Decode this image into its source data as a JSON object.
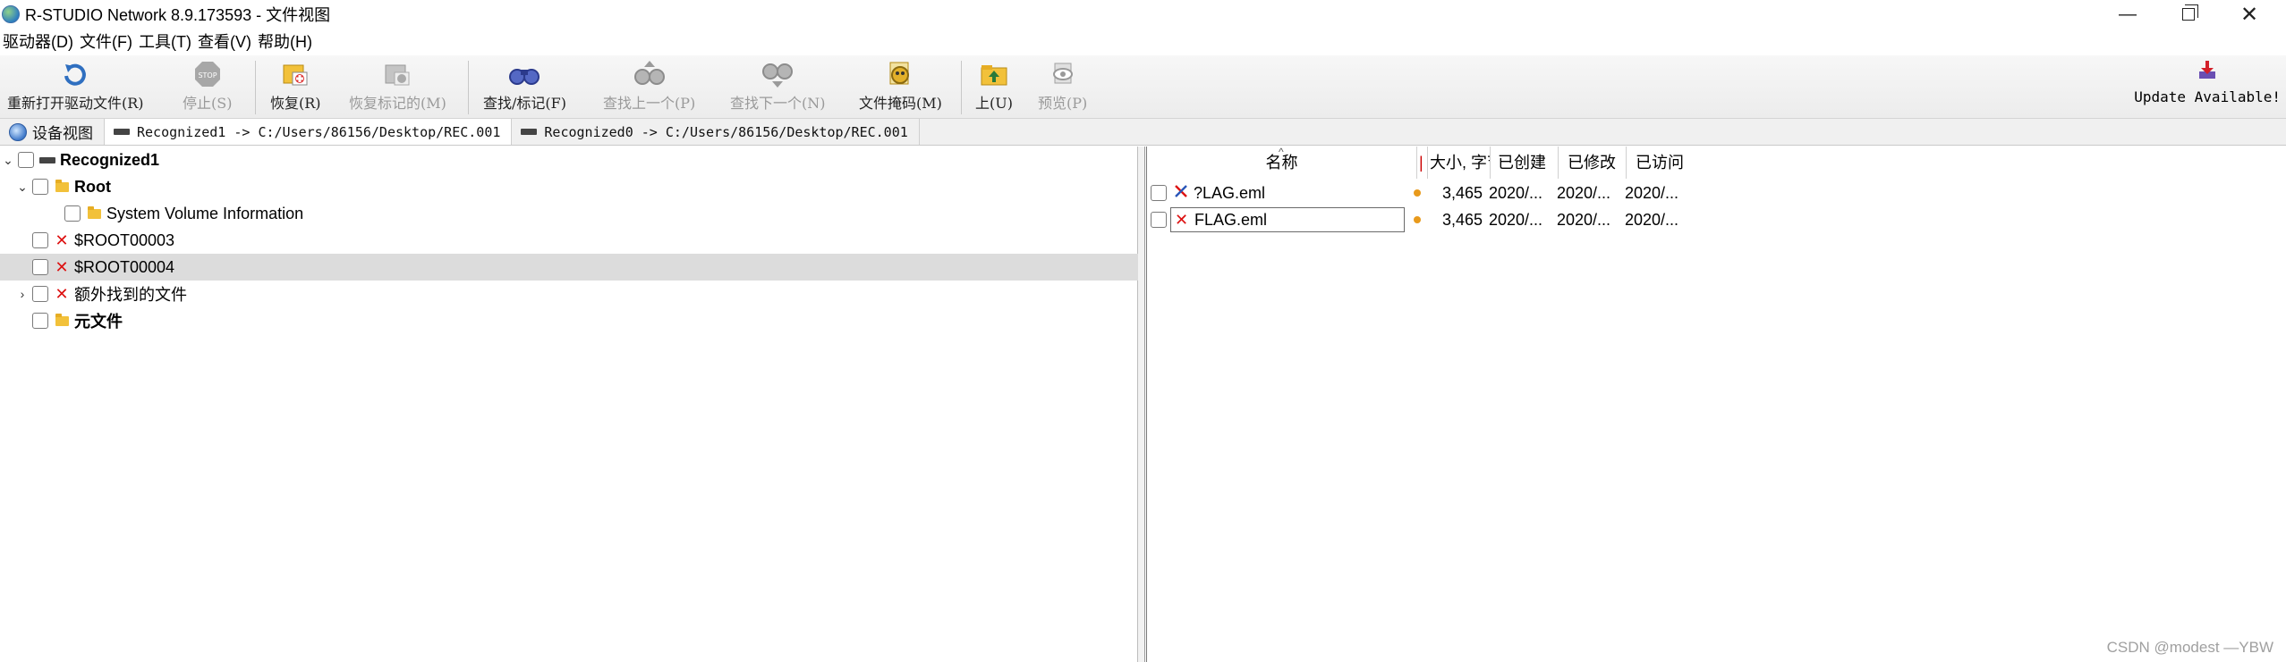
{
  "window": {
    "title": "R-STUDIO Network 8.9.173593 - 文件视图",
    "minimize_glyph": "—",
    "close_glyph": "✕"
  },
  "menu": [
    "驱动器(D)",
    "文件(F)",
    "工具(T)",
    "查看(V)",
    "帮助(H)"
  ],
  "toolbar": {
    "reopen": "重新打开驱动文件(R)",
    "stop": "停止(S)",
    "recover": "恢复(R)",
    "recover_marked": "恢复标记的(M)",
    "find_mark": "查找/标记(F)",
    "find_prev": "查找上一个(P)",
    "find_next": "查找下一个(N)",
    "file_mask": "文件掩码(M)",
    "up": "上(U)",
    "preview": "预览(P)",
    "update": "Update Available!"
  },
  "tabs": [
    {
      "label": "设备视图"
    },
    {
      "label": "Recognized1 -> C:/Users/86156/Desktop/REC.001"
    },
    {
      "label": "Recognized0 -> C:/Users/86156/Desktop/REC.001"
    }
  ],
  "tree": [
    {
      "label": "Recognized1",
      "icon": "drive-icon",
      "bold": true,
      "expanded": true
    },
    {
      "label": "Root",
      "icon": "folder-icon",
      "bold": true,
      "expanded": true
    },
    {
      "label": "System Volume Information",
      "icon": "folder-icon",
      "bold": false
    },
    {
      "label": "$ROOT00003",
      "icon": "deleted-icon",
      "bold": false
    },
    {
      "label": "$ROOT00004",
      "icon": "deleted-icon",
      "bold": false,
      "selected": true
    },
    {
      "label": "额外找到的文件",
      "icon": "deleted-icon",
      "bold": false,
      "expanded": false
    },
    {
      "label": "元文件",
      "icon": "folder-icon",
      "bold": true
    }
  ],
  "file_list": {
    "columns": {
      "name": "名称",
      "flag": "|",
      "size": "大小, 字节",
      "created": "已创建",
      "modified": "已修改",
      "accessed": "已访问"
    },
    "rows": [
      {
        "name": "?LAG.eml",
        "size": "3,465",
        "created": "2020/...",
        "modified": "2020/...",
        "accessed": "2020/...",
        "icon": "partially-deleted-icon"
      },
      {
        "name": "FLAG.eml",
        "size": "3,465",
        "created": "2020/...",
        "modified": "2020/...",
        "accessed": "2020/...",
        "icon": "deleted-icon",
        "focused": true
      }
    ]
  },
  "watermark": "CSDN @modest —YBW",
  "colors": {
    "deleted": "#dd1111",
    "status_dot": "#e89a1c",
    "selected_row": "#dcdcdc"
  }
}
